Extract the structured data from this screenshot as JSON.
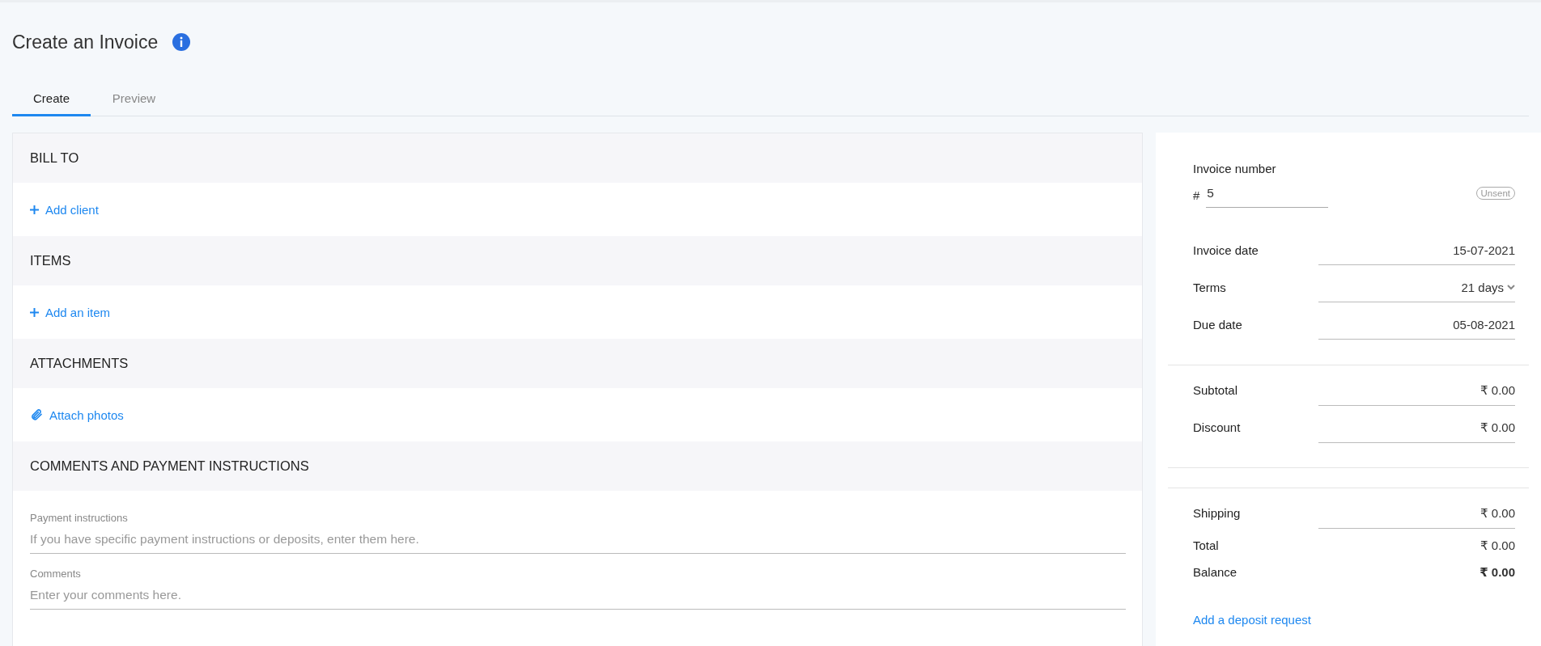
{
  "page": {
    "title": "Create an Invoice"
  },
  "tabs": [
    {
      "label": "Create",
      "selected": true
    },
    {
      "label": "Preview",
      "selected": false
    }
  ],
  "sections": [
    {
      "heading": "BILL TO",
      "kind": "add",
      "link": "Add client"
    },
    {
      "heading": "ITEMS",
      "kind": "add",
      "link": "Add an item"
    },
    {
      "heading": "ATTACHMENTS",
      "kind": "attach",
      "link": "Attach photos"
    },
    {
      "heading": "COMMENTS AND PAYMENT INSTRUCTIONS",
      "kind": "fields",
      "fields": [
        {
          "label": "Payment instructions",
          "placeholder": "If you have specific payment instructions or deposits, enter them here."
        },
        {
          "label": "Comments",
          "placeholder": "Enter your comments here."
        }
      ]
    }
  ],
  "invoice": {
    "label": "Invoice number",
    "prefix": "#",
    "value": "5",
    "status": "Unsent"
  },
  "summary_groups": [
    {
      "kind": "dates",
      "rows": [
        {
          "label": "Invoice date",
          "value": "15-07-2021",
          "kind": "input"
        },
        {
          "label": "Terms",
          "value": "21 days",
          "kind": "select"
        },
        {
          "label": "Due date",
          "value": "05-08-2021",
          "kind": "input"
        }
      ]
    },
    {
      "kind": "subtotals",
      "rows": [
        {
          "label": "Subtotal",
          "value": "₹ 0.00",
          "kind": "input"
        },
        {
          "label": "Discount",
          "value": "₹ 0.00",
          "kind": "input"
        }
      ]
    },
    {
      "kind": "totals",
      "rows": [
        {
          "label": "Shipping",
          "value": "₹ 0.00",
          "kind": "input"
        },
        {
          "label": "Total",
          "value": "₹ 0.00",
          "kind": "plain"
        },
        {
          "label": "Balance",
          "value": "₹ 0.00",
          "kind": "bold"
        }
      ]
    }
  ],
  "deposit_link": "Add a deposit request"
}
